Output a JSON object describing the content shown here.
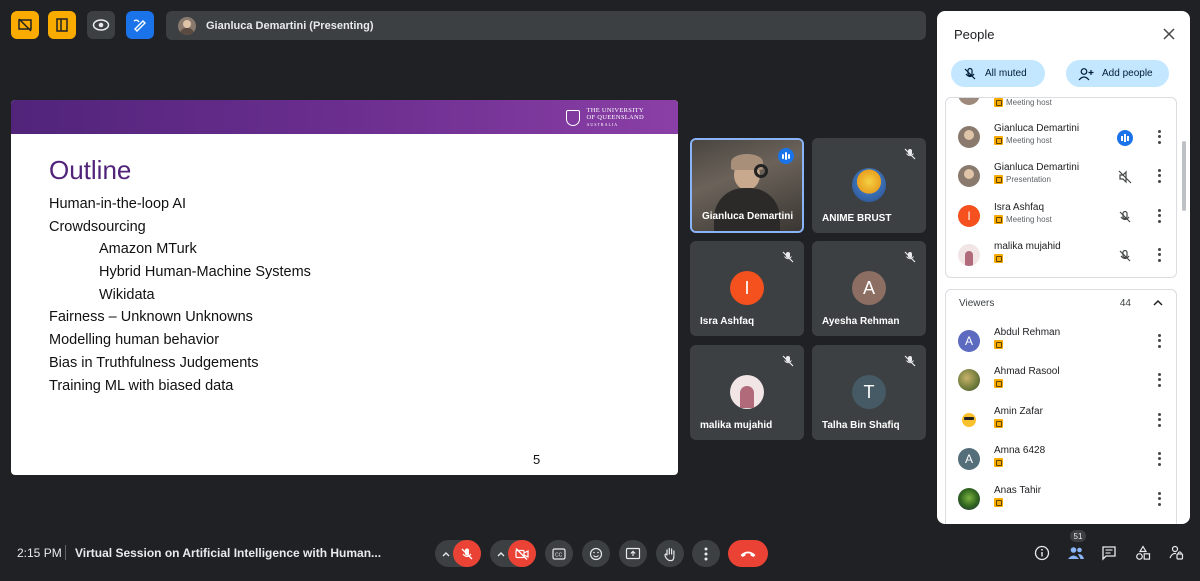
{
  "toolbar": {
    "icons": [
      "slides-off-icon",
      "slide-panel-icon",
      "eye-icon",
      "annotate-icon"
    ],
    "colors": {
      "yellow": "#f9ab00",
      "blue": "#1a73e8",
      "dark": "#3c4043"
    }
  },
  "presenting": {
    "name": "Gianluca Demartini (Presenting)"
  },
  "slide": {
    "logo_line1": "THE UNIVERSITY",
    "logo_line2": "OF QUEENSLAND",
    "logo_line3": "AUSTRALIA",
    "title": "Outline",
    "items": [
      "Human-in-the-loop AI",
      "Crowdsourcing",
      "Amazon MTurk",
      "Hybrid Human-Machine Systems",
      "Wikidata",
      "Fairness – Unknown Unknowns",
      "Modelling human behavior",
      "Bias in Truthfulness Judgements",
      "Training ML with biased data"
    ],
    "page_number": "5",
    "accent": "#51247a"
  },
  "tiles": [
    {
      "name": "Gianluca Demartini",
      "initial": ""
    },
    {
      "name": "ANIME BRUST",
      "initial": ""
    },
    {
      "name": "Isra Ashfaq",
      "initial": "I",
      "color": "#f4511e"
    },
    {
      "name": "Ayesha Rehman",
      "initial": "A",
      "color": "#8d6e63"
    },
    {
      "name": "malika mujahid",
      "initial": ""
    },
    {
      "name": "Talha Bin Shafiq",
      "initial": "T",
      "color": "#455a64"
    }
  ],
  "panel": {
    "title": "People",
    "all_muted": "All muted",
    "add_people": "Add people",
    "hosts": [
      {
        "name": "Gianluca Demartini",
        "role": "Meeting host"
      },
      {
        "name": "Gianluca Demartini",
        "role": "Presentation"
      },
      {
        "name": "Isra Ashfaq",
        "role": "Meeting host",
        "initial": "I"
      },
      {
        "name": "malika mujahid",
        "role": ""
      }
    ],
    "partial_role": "Meeting host",
    "viewers_label": "Viewers",
    "viewers_count": "44",
    "viewers": [
      {
        "name": "Abdul Rehman",
        "initial": "A"
      },
      {
        "name": "Ahmad Rasool",
        "initial": ""
      },
      {
        "name": "Amin Zafar",
        "initial": ""
      },
      {
        "name": "Amna 6428",
        "initial": "A"
      },
      {
        "name": "Anas Tahir",
        "initial": ""
      }
    ]
  },
  "bottom": {
    "time": "2:15 PM",
    "meeting_title": "Virtual Session on Artificial Intelligence with Human...",
    "people_count": "51"
  }
}
